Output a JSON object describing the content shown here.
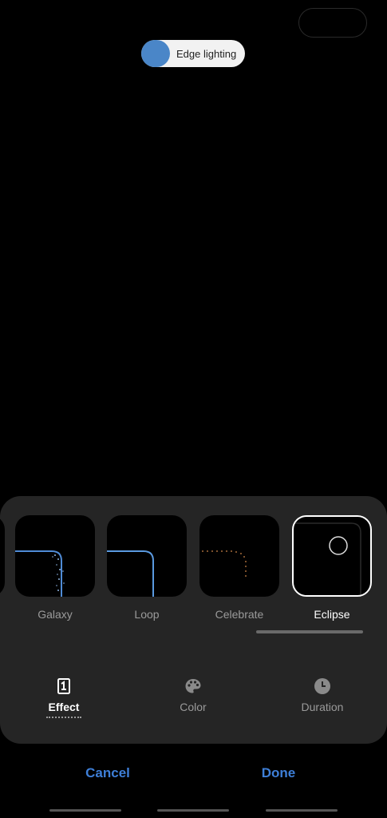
{
  "pill": {
    "label": "Edge lighting",
    "toggle_on": true,
    "toggle_color": "#4a86c8"
  },
  "effects": [
    {
      "label": "Galaxy",
      "selected": false
    },
    {
      "label": "Loop",
      "selected": false
    },
    {
      "label": "Celebrate",
      "selected": false
    },
    {
      "label": "Eclipse",
      "selected": true
    }
  ],
  "tabs": [
    {
      "label": "Effect",
      "icon": "effect-icon",
      "active": true
    },
    {
      "label": "Color",
      "icon": "palette-icon",
      "active": false
    },
    {
      "label": "Duration",
      "icon": "clock-icon",
      "active": false
    }
  ],
  "actions": {
    "cancel_label": "Cancel",
    "done_label": "Done",
    "accent_color": "#3e7fd8"
  }
}
